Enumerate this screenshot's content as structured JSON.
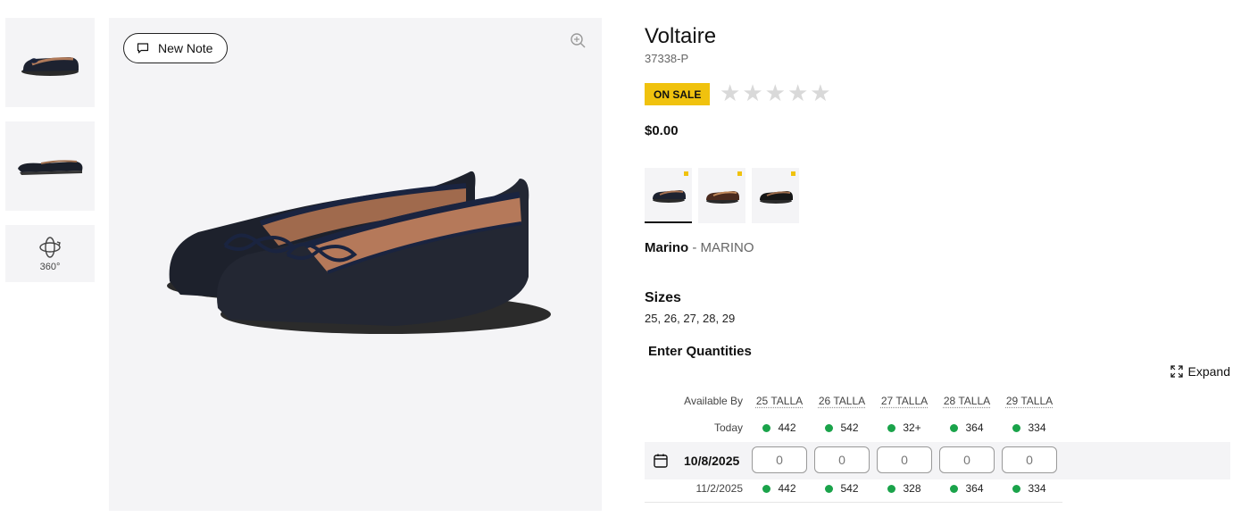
{
  "gallery": {
    "new_note_label": "New Note",
    "rotate_label": "360°"
  },
  "product": {
    "name": "Voltaire",
    "sku": "37338-P",
    "badge": "ON SALE",
    "rating": 0,
    "price": "$0.00",
    "color_name": "Marino",
    "color_sep": " - ",
    "color_code": "MARINO",
    "swatch_count": 3
  },
  "sizes": {
    "heading": "Sizes",
    "values": "25, 26, 27, 28, 29"
  },
  "quantities": {
    "heading": "Enter Quantities",
    "expand_label": "Expand",
    "available_by_label": "Available By",
    "size_headers": [
      "25 TALLA",
      "26 TALLA",
      "27 TALLA",
      "28 TALLA",
      "29 TALLA"
    ],
    "rows": [
      {
        "label": "Today",
        "stock": [
          "442",
          "542",
          "32+",
          "364",
          "334"
        ]
      },
      {
        "label": "10/8/2025",
        "inputs": [
          "0",
          "0",
          "0",
          "0",
          "0"
        ]
      },
      {
        "label": "11/2/2025",
        "stock": [
          "442",
          "542",
          "328",
          "364",
          "334"
        ]
      }
    ]
  },
  "colors": {
    "sale_badge": "#f0c20e",
    "in_stock": "#1aa34a",
    "image_bg": "#f4f4f6"
  },
  "icons": {
    "note": "speech-bubble-icon",
    "zoom": "zoom-in-icon",
    "rotate": "rotate-360-icon",
    "expand": "expand-arrows-icon",
    "calendar": "calendar-icon",
    "star": "star-icon"
  }
}
